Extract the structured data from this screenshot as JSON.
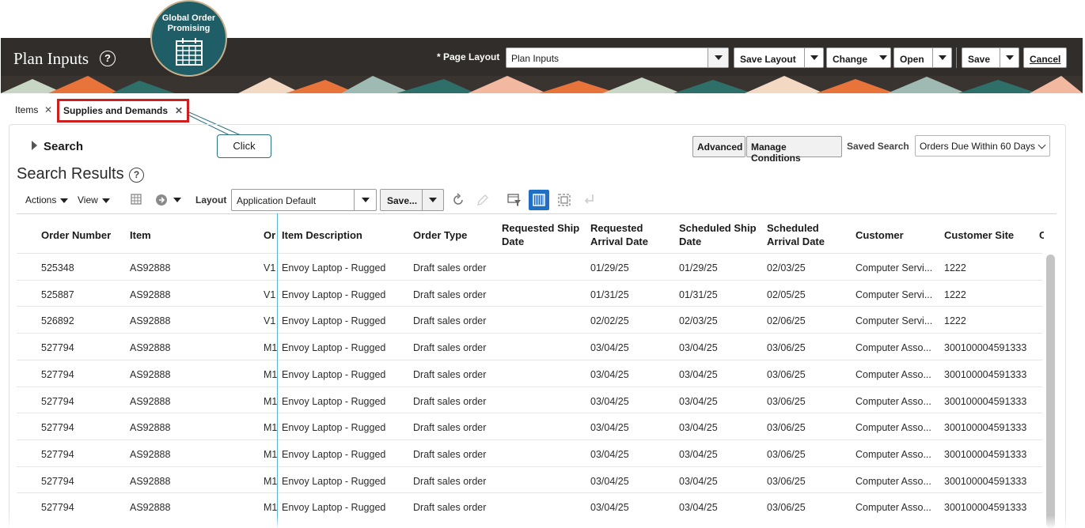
{
  "header": {
    "title": "Plan Inputs",
    "badge_label": "Global Order Promising",
    "page_layout_label": "* Page Layout",
    "page_layout_value": "Plan Inputs",
    "buttons": {
      "save_layout": "Save Layout",
      "change": "Change",
      "open": "Open",
      "save": "Save",
      "cancel": "Cancel"
    }
  },
  "tabs": [
    {
      "label": "Items"
    },
    {
      "label": "Supplies and Demands"
    }
  ],
  "callout": "Click",
  "search": {
    "heading": "Search",
    "advanced": "Advanced",
    "manage_conditions": "Manage Conditions",
    "saved_search_label": "Saved Search",
    "saved_search_value": "Orders Due Within 60 Days"
  },
  "results": {
    "heading": "Search Results",
    "toolbar": {
      "actions": "Actions",
      "view": "View",
      "layout_label": "Layout",
      "layout_value": "Application Default",
      "save": "Save..."
    },
    "columns": [
      "Order Number",
      "Item",
      "Or",
      "Item Description",
      "Order Type",
      "Requested Ship Date",
      "Requested Arrival Date",
      "Scheduled Ship Date",
      "Scheduled Arrival Date",
      "Customer",
      "Customer Site",
      "C"
    ],
    "rows": [
      [
        "525348",
        "AS92888",
        "V1",
        "Envoy Laptop - Rugged",
        "Draft sales order",
        "",
        "01/29/25",
        "01/29/25",
        "02/03/25",
        "Computer Servi...",
        "1222"
      ],
      [
        "525887",
        "AS92888",
        "V1",
        "Envoy Laptop - Rugged",
        "Draft sales order",
        "",
        "01/31/25",
        "01/31/25",
        "02/05/25",
        "Computer Servi...",
        "1222"
      ],
      [
        "526892",
        "AS92888",
        "V1",
        "Envoy Laptop - Rugged",
        "Draft sales order",
        "",
        "02/02/25",
        "02/03/25",
        "02/06/25",
        "Computer Servi...",
        "1222"
      ],
      [
        "527794",
        "AS92888",
        "M1",
        "Envoy Laptop - Rugged",
        "Draft sales order",
        "",
        "03/04/25",
        "03/04/25",
        "03/06/25",
        "Computer Asso...",
        "300100004591333"
      ],
      [
        "527794",
        "AS92888",
        "M1",
        "Envoy Laptop - Rugged",
        "Draft sales order",
        "",
        "03/04/25",
        "03/04/25",
        "03/06/25",
        "Computer Asso...",
        "300100004591333"
      ],
      [
        "527794",
        "AS92888",
        "M1",
        "Envoy Laptop - Rugged",
        "Draft sales order",
        "",
        "03/04/25",
        "03/04/25",
        "03/06/25",
        "Computer Asso...",
        "300100004591333"
      ],
      [
        "527794",
        "AS92888",
        "M1",
        "Envoy Laptop - Rugged",
        "Draft sales order",
        "",
        "03/04/25",
        "03/04/25",
        "03/06/25",
        "Computer Asso...",
        "300100004591333"
      ],
      [
        "527794",
        "AS92888",
        "M1",
        "Envoy Laptop - Rugged",
        "Draft sales order",
        "",
        "03/04/25",
        "03/04/25",
        "03/06/25",
        "Computer Asso...",
        "300100004591333"
      ],
      [
        "527794",
        "AS92888",
        "M1",
        "Envoy Laptop - Rugged",
        "Draft sales order",
        "",
        "03/04/25",
        "03/04/25",
        "03/06/25",
        "Computer Asso...",
        "300100004591333"
      ],
      [
        "527794",
        "AS92888",
        "M1",
        "Envoy Laptop - Rugged",
        "Draft sales order",
        "",
        "03/04/25",
        "03/04/25",
        "03/06/25",
        "Computer Asso...",
        "300100004591333"
      ]
    ]
  },
  "colors": {
    "header_bg": "#312d2a",
    "badge_bg": "#1f5e66",
    "highlight_red": "#cc1f1f",
    "accent_blue": "#1f6fc5"
  }
}
